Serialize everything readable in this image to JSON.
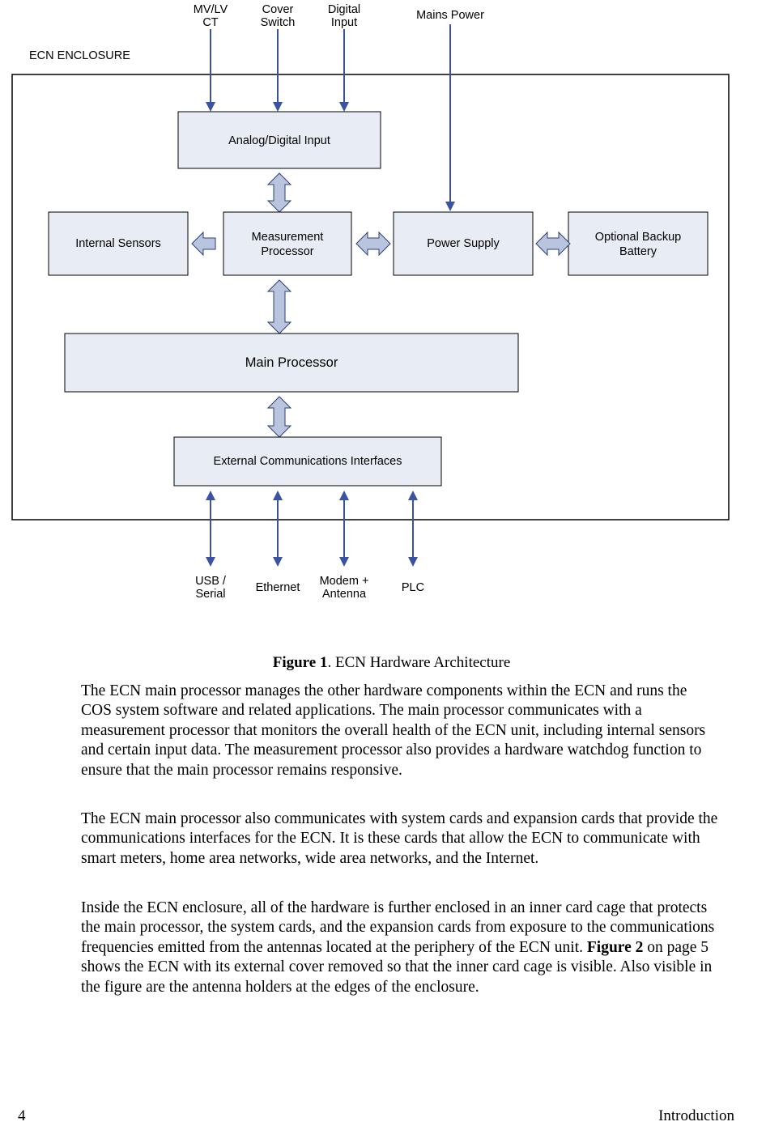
{
  "top_inputs": {
    "mvlv": "MV/LV",
    "ct": "CT",
    "cover": "Cover",
    "switch": "Switch",
    "digital": "Digital",
    "input": "Input",
    "mains": "Mains Power"
  },
  "enclosure_label": "ECN ENCLOSURE",
  "blocks": {
    "adi": "Analog/Digital Input",
    "int_sensors": "Internal Sensors",
    "meas1": "Measurement",
    "meas2": "Processor",
    "psu": "Power Supply",
    "bat1": "Optional Backup",
    "bat2": "Battery",
    "main": "Main Processor",
    "ext": "External Communications Interfaces"
  },
  "bottom_outputs": {
    "usb1": "USB /",
    "usb2": "Serial",
    "eth": "Ethernet",
    "modem1": "Modem +",
    "modem2": "Antenna",
    "plc": "PLC"
  },
  "caption_bold": "Figure 1",
  "caption_rest": ". ECN Hardware Architecture",
  "para1": "The ECN main processor manages the other hardware components within the ECN and runs the COS system software and related applications.  The main processor communicates with a measurement processor that monitors the overall health of the ECN unit, including internal sensors and certain input data.  The measurement processor also provides a hardware watchdog function to ensure that the main processor remains responsive.",
  "para2": "The ECN main processor also communicates with system cards and expansion cards that provide the communications interfaces for the ECN.  It is these cards that allow the ECN to communicate with smart meters, home area networks, wide area networks, and the Internet.",
  "para3a": "Inside the ECN enclosure, all of the hardware is further enclosed in an inner card cage that protects the main processor, the system cards, and the expansion cards from exposure to the communications frequencies emitted from the antennas located at the periphery of the ECN unit.  ",
  "para3b": "Figure 2",
  "para3c": " on page 5 shows the ECN with its external cover removed so that the inner card cage is visible.  Also visible in the figure are the antenna holders at the edges of the enclosure.",
  "page_num": "4",
  "section": "Introduction"
}
